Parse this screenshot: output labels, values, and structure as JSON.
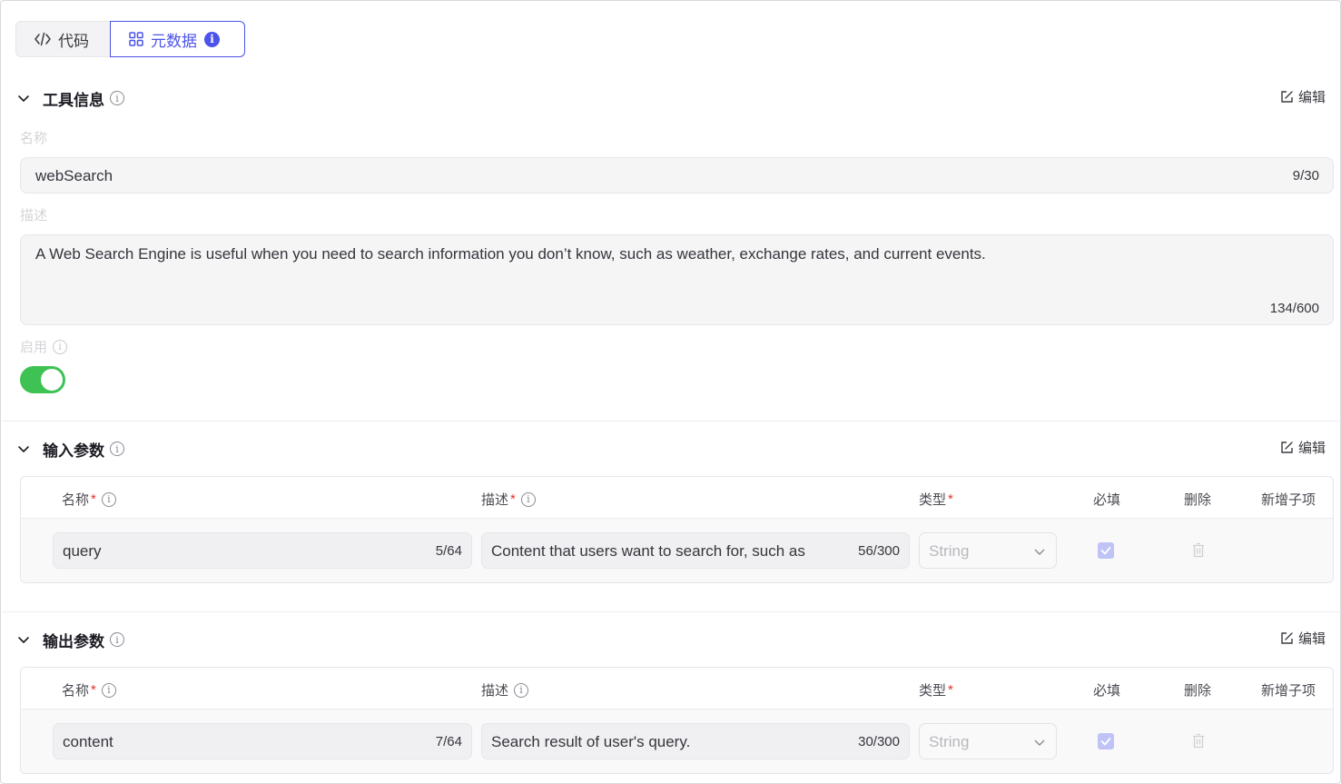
{
  "tabs": [
    {
      "label": "代码",
      "icon": "code-icon"
    },
    {
      "label": "元数据",
      "icon": "grid-icon",
      "badge": "i"
    }
  ],
  "tool_info": {
    "title": "工具信息",
    "edit_label": "编辑",
    "name_label": "名称",
    "name_value": "webSearch",
    "name_count": "9/30",
    "desc_label": "描述",
    "desc_value": "A Web Search Engine is useful when you need to search information you don’t know, such as weather, exchange rates, and current events.",
    "desc_count": "134/600",
    "enable_label": "启用",
    "enabled": true
  },
  "input_params": {
    "title": "输入参数",
    "edit_label": "编辑",
    "headers": {
      "name": "名称",
      "desc": "描述",
      "type": "类型",
      "required": "必填",
      "delete": "删除",
      "add_child": "新增子项"
    },
    "rows": [
      {
        "name": "query",
        "name_count": "5/64",
        "desc": "Content that users want to search for, such as",
        "desc_count": "56/300",
        "type": "String",
        "required": true
      }
    ]
  },
  "output_params": {
    "title": "输出参数",
    "edit_label": "编辑",
    "headers": {
      "name": "名称",
      "desc": "描述",
      "type": "类型",
      "required": "必填",
      "delete": "删除",
      "add_child": "新增子项"
    },
    "rows": [
      {
        "name": "content",
        "name_count": "7/64",
        "desc": "Search result of user's query.",
        "desc_count": "30/300",
        "type": "String",
        "required": true
      }
    ]
  },
  "colors": {
    "accent": "#4d53e8",
    "toggle_on": "#3ec254",
    "required": "#e5322d"
  }
}
